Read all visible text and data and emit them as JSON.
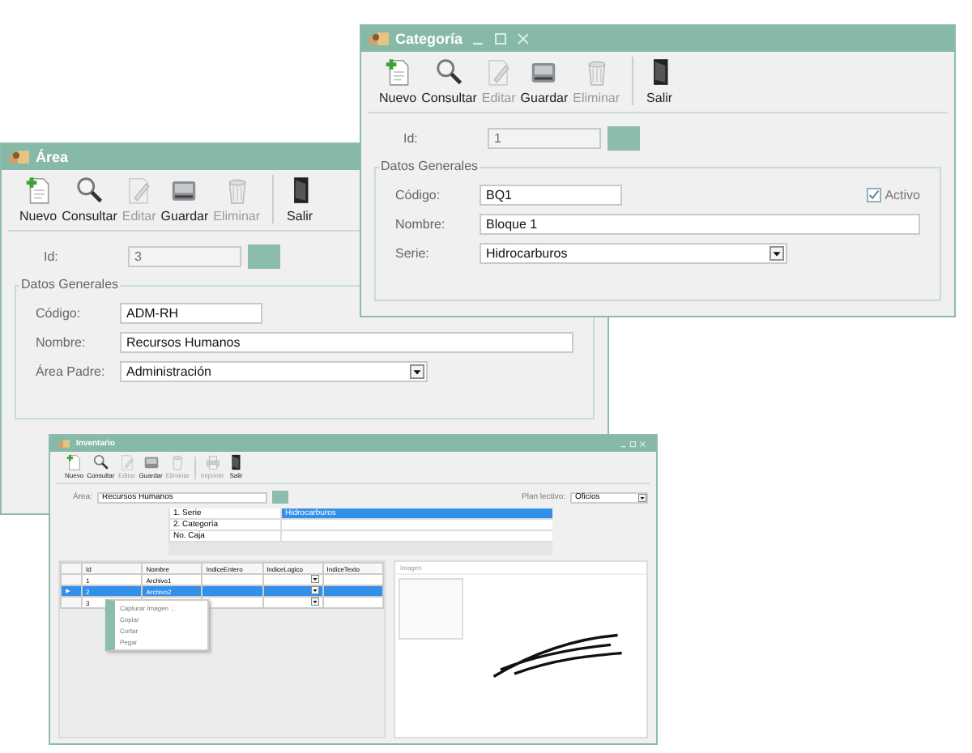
{
  "categoria_window": {
    "title": "Categoría",
    "controls": true,
    "toolbar": [
      {
        "kind": "new",
        "label": "Nuevo",
        "disabled": false
      },
      {
        "kind": "search",
        "label": "Consultar",
        "disabled": false
      },
      {
        "kind": "edit",
        "label": "Editar",
        "disabled": true
      },
      {
        "kind": "save",
        "label": "Guardar",
        "disabled": false
      },
      {
        "kind": "delete",
        "label": "Eliminar",
        "disabled": true
      },
      {
        "kind": "exit",
        "label": "Salir",
        "disabled": false
      }
    ],
    "id_field": {
      "label": "Id:",
      "value": "1",
      "disabled": true
    },
    "group_title": "Datos Generales",
    "fields": [
      {
        "kind": "short",
        "label": "Código:",
        "value": "BQ1"
      },
      {
        "kind": "wide",
        "label": "Nombre:",
        "value": "Bloque 1"
      },
      {
        "kind": "select",
        "label": "Serie:",
        "value": "Hidrocarburos"
      }
    ],
    "active_checkbox": {
      "label": "Activo",
      "checked": true
    }
  },
  "area_window": {
    "title": "Área",
    "controls": false,
    "toolbar": [
      {
        "kind": "new",
        "label": "Nuevo",
        "disabled": false
      },
      {
        "kind": "search",
        "label": "Consultar",
        "disabled": false
      },
      {
        "kind": "edit",
        "label": "Editar",
        "disabled": true
      },
      {
        "kind": "save",
        "label": "Guardar",
        "disabled": false
      },
      {
        "kind": "delete",
        "label": "Eliminar",
        "disabled": true
      },
      {
        "kind": "exit",
        "label": "Salir",
        "disabled": false
      }
    ],
    "id_field": {
      "label": "Id:",
      "value": "3",
      "disabled": true
    },
    "group_title": "Datos Generales",
    "fields": [
      {
        "kind": "short",
        "label": "Código:",
        "value": "ADM-RH"
      },
      {
        "kind": "wide",
        "label": "Nombre:",
        "value": "Recursos Humanos"
      },
      {
        "kind": "select",
        "label": "Área Padre:",
        "value": "Administración"
      }
    ]
  },
  "inventario_window": {
    "title": "Inventario",
    "toolbar": [
      {
        "kind": "new",
        "label": "Nuevo",
        "disabled": false
      },
      {
        "kind": "search",
        "label": "Consultar",
        "disabled": false
      },
      {
        "kind": "edit",
        "label": "Editar",
        "disabled": true
      },
      {
        "kind": "save",
        "label": "Guardar",
        "disabled": false
      },
      {
        "kind": "delete",
        "label": "Eliminar",
        "disabled": true
      },
      {
        "kind": "print",
        "label": "Imprimir",
        "disabled": true
      },
      {
        "kind": "exit",
        "label": "Salir",
        "disabled": false
      }
    ],
    "area_field": {
      "label": "Área:",
      "value": "Recursos Humanos"
    },
    "plan_field": {
      "label": "Plan lectivo:",
      "value": "Oficios"
    },
    "properties": [
      {
        "name": "1. Serie",
        "value": "Hidrocarburos",
        "selected": true
      },
      {
        "name": "2. Categoría",
        "selected": false
      },
      {
        "name": "No. Caja",
        "selected": false
      }
    ],
    "table": {
      "columns": [
        "Id",
        "Nombre",
        "IndiceEntero",
        "IndiceLogico",
        "IndiceTexto"
      ],
      "rows": [
        {
          "id": "1",
          "nombre": "Archivo1",
          "selected": false
        },
        {
          "id": "2",
          "nombre": "Archivo2",
          "selected": true
        },
        {
          "id": "3",
          "selected": false
        }
      ]
    },
    "context_menu": [
      "Capturar Imagen ...",
      "Copiar",
      "Cortar",
      "Pegar"
    ],
    "image_panel": {
      "title": "Imagen"
    }
  }
}
